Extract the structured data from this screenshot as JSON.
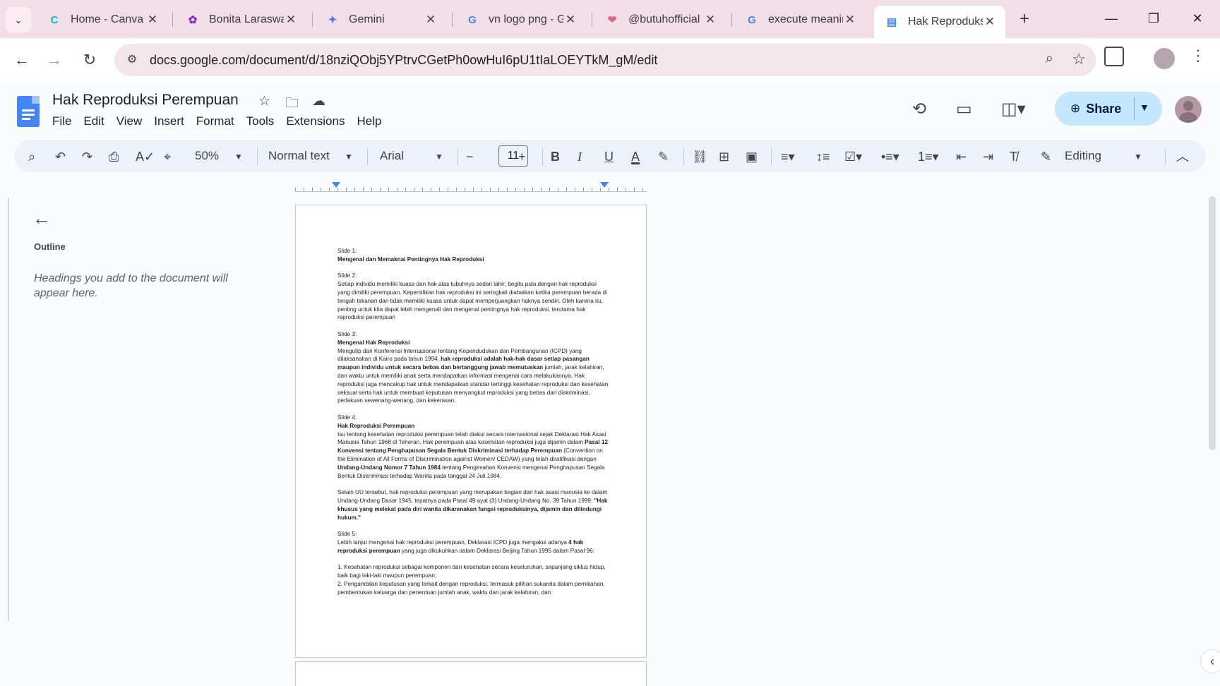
{
  "browser": {
    "tabs": [
      {
        "title": "Home - Canva",
        "favicon": "canva-icon",
        "fav_color": "#00c4cc",
        "fav_glyph": "C"
      },
      {
        "title": "Bonita Laraswati",
        "favicon": "canva-design-icon",
        "fav_color": "#7d2ae8",
        "fav_glyph": "✿"
      },
      {
        "title": "Gemini",
        "favicon": "gemini-icon",
        "fav_color": "#4b7bec",
        "fav_glyph": "✦"
      },
      {
        "title": "vn logo png - Google Search",
        "favicon": "google-icon",
        "fav_color": "#4285f4",
        "fav_glyph": "G"
      },
      {
        "title": "@butuhofficial",
        "favicon": "heart-icon",
        "fav_color": "#e8607d",
        "fav_glyph": "❤"
      },
      {
        "title": "execute meaning - Google Search",
        "favicon": "google-icon",
        "fav_color": "#4285f4",
        "fav_glyph": "G"
      },
      {
        "title": "Hak Reproduksi Perempuan",
        "favicon": "docs-icon",
        "fav_color": "#4285f4",
        "fav_glyph": "▤"
      }
    ],
    "url": "docs.google.com/document/d/18nziQObj5YPtrvCGetPh0owHuI6pU1tIaLOEYTkM_gM/edit",
    "accent": "#f2dee6"
  },
  "doc": {
    "title": "Hak Reproduksi Perempuan",
    "menu": [
      "File",
      "Edit",
      "View",
      "Insert",
      "Format",
      "Tools",
      "Extensions",
      "Help"
    ],
    "share_label": "Share"
  },
  "toolbar": {
    "zoom": "50%",
    "style": "Normal text",
    "font": "Arial",
    "font_size": "11",
    "mode": "Editing"
  },
  "outline": {
    "title": "Outline",
    "hint": "Headings you add to the document will appear here."
  },
  "page": {
    "paragraphs": [
      [
        {
          "t": "Slide 1:"
        }
      ],
      [
        {
          "t": "Mengenal dan Memaknai Pentingnya Hak Reproduksi",
          "b": true
        }
      ],
      [],
      [
        {
          "t": "Slide 2:"
        }
      ],
      [
        {
          "t": "Setiap individu memiliki kuasa dan hak atas tubuhnya sedari lahir; begitu pula dengan hak reproduksi yang dimiliki perempuan. Kepemilikan hak reproduksi ini seringkali diabaikan ketika perempuan berada di tengah tekanan dan tidak memiliki kuasa untuk dapat memperjuangkan haknya sendiri. Oleh karena itu, penting untuk kita dapat lebih mengenali dan mengenal pentingnya hak reproduksi, terutama hak reproduksi perempuan"
        }
      ],
      [],
      [
        {
          "t": "Slide 3:"
        }
      ],
      [
        {
          "t": "Mengenal Hak Reproduksi",
          "b": true
        }
      ],
      [
        {
          "t": "Mengutip dari Konferensi Internasional tentang Kependudukan dan Pembangunan (ICPD) yang dilaksanakan di Kairo pada tahun 1994, "
        },
        {
          "t": "hak reproduksi adalah hak-hak dasar setiap pasangan maupun individu untuk secara bebas dan bertanggung jawab memutuskan",
          "b": true
        },
        {
          "t": " jumlah, jarak kelahiran, dan waktu untuk memiliki anak serta mendapatkan informasi mengenai cara melakukannya. Hak reproduksi juga mencakup hak untuk mendapatkan standar tertinggi kesehatan reproduksi dan kesehatan seksual serta hak untuk membuat keputusan menyangkut reproduksi yang bebas dari diskriminasi, perlakuan sewenang-wenang, dan kekerasan."
        }
      ],
      [],
      [
        {
          "t": "Slide 4:"
        }
      ],
      [
        {
          "t": "Hak Reproduksi Perempuan",
          "b": true
        }
      ],
      [
        {
          "t": "Isu tentang kesehatan reproduksi perempuan telah diakui secara internasional sejak Deklarasi Hak Asasi Manusia Tahun 1968 di Teheran. Hak perempuan atas kesehatan reproduksi juga dijamin dalam "
        },
        {
          "t": "Pasal 12 Konvensi tentang Penghapusan Segala Bentuk Diskriminasi terhadap Perempuan",
          "b": true
        },
        {
          "t": " (Convention on the Elimination of All Forms of Discrimination against Women/ CEDAW) yang telah diratifikasi dengan "
        },
        {
          "t": "Undang-Undang Nomor 7 Tahun 1984",
          "b": true
        },
        {
          "t": " tentang Pengesahan Konvensi mengenai Penghapusan Segala Bentuk Diskriminasi terhadap Wanita pada tanggal 24 Juli 1984."
        }
      ],
      [],
      [
        {
          "t": "Selain UU tersebut, hak reproduksi perempuan yang merupakan bagian dari hak asasi manusia ke dalam Undang-Undang Dasar 1945, tepatnya pada Pasal 49 ayat (3) Undang-Undang No. 39 Tahun 1999: "
        },
        {
          "t": "\"Hak khusus yang melekat pada diri wanita dikarenakan fungsi reproduksinya, dijamin dan dilindungi hukum.\"",
          "b": true
        }
      ],
      [],
      [
        {
          "t": "Slide 5:"
        }
      ],
      [
        {
          "t": "Lebih lanjut mengenai hak reproduksi perempuan, Deklarasi ICPD juga mengakui adanya "
        },
        {
          "t": "4 hak reproduksi perempuan",
          "b": true
        },
        {
          "t": " yang juga dikukuhkan dalam Deklarasi Beijing Tahun 1995 dalam Pasal 96:"
        }
      ],
      [],
      [
        {
          "t": "1. Kesehatan reproduksi sebagai komponen dari kesehatan secara keseluruhan, sepanjang siklus hidup, baik bagi laki-laki maupun perempuan;"
        }
      ],
      [
        {
          "t": "2. Pengambilan keputusan yang terkait dengan reproduksi, termasuk pilihan sukarela dalam pernikahan, pembentukan keluarga dan penentuan jumlah anak, waktu dan jarak kelahiran, dan"
        }
      ]
    ]
  }
}
